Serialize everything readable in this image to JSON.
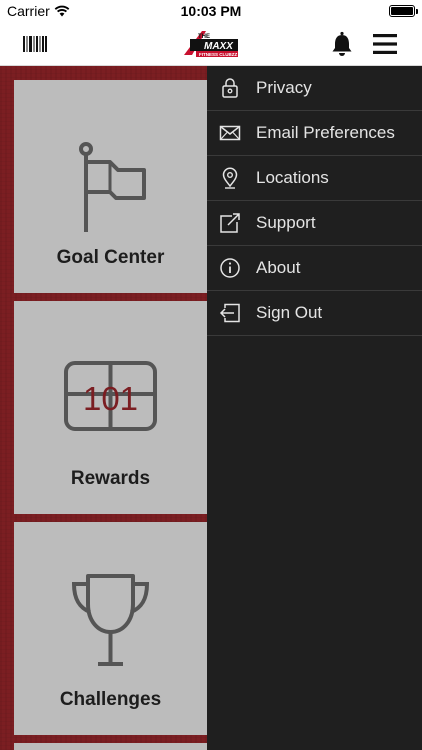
{
  "status_bar": {
    "carrier": "Carrier",
    "time": "10:03 PM",
    "battery_level": 1.0
  },
  "nav_bar": {
    "logo": {
      "top_text": "THE",
      "brand_text": "MAXX",
      "sub_text": "FITNESS CLUBZZ"
    },
    "left_icon": "barcode-icon",
    "right_icons": [
      "bell-icon",
      "hamburger-menu-icon"
    ]
  },
  "tiles": [
    {
      "label": "Goal Center",
      "icon": "flag-icon"
    },
    {
      "label": "Rewards",
      "icon": "ticket-icon",
      "icon_text": "101"
    },
    {
      "label": "Challenges",
      "icon": "trophy-icon"
    }
  ],
  "drawer": {
    "items": [
      {
        "label": "Privacy",
        "icon": "lock-icon"
      },
      {
        "label": "Email Preferences",
        "icon": "envelope-icon"
      },
      {
        "label": "Locations",
        "icon": "location-pin-icon"
      },
      {
        "label": "Support",
        "icon": "external-link-icon"
      },
      {
        "label": "About",
        "icon": "info-icon"
      },
      {
        "label": "Sign Out",
        "icon": "sign-out-icon"
      }
    ]
  },
  "colors": {
    "background_red": "#7b1e22",
    "tile_gray": "#bcbcbc",
    "drawer_bg": "#1f1f1f",
    "drawer_text": "#e4e4e4",
    "icon_gray": "#555555",
    "ticket_text_red": "#7b1e22"
  }
}
